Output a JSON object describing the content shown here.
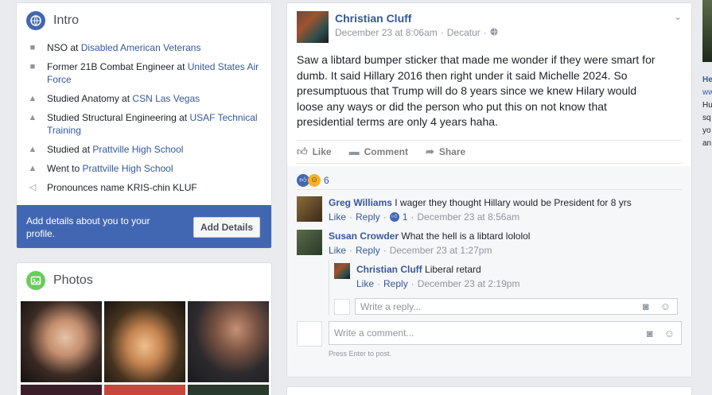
{
  "intro": {
    "title": "Intro",
    "items": [
      {
        "icon": "briefcase-icon",
        "prefix": "NSO at ",
        "link": "Disabled American Veterans"
      },
      {
        "icon": "briefcase-icon",
        "prefix": "Former 21B Combat Engineer at ",
        "link": "United States Air Force"
      },
      {
        "icon": "graduation-cap-icon",
        "prefix": "Studied Anatomy at ",
        "link": "CSN Las Vegas"
      },
      {
        "icon": "graduation-cap-icon",
        "prefix": "Studied Structural Engineering at ",
        "link": "USAF Technical Training"
      },
      {
        "icon": "graduation-cap-icon",
        "prefix": "Studied at ",
        "link": "Prattville High School"
      },
      {
        "icon": "graduation-cap-icon",
        "prefix": "Went to ",
        "link": "Prattville High School"
      },
      {
        "icon": "speaker-icon",
        "prefix": "Pronounces name KRIS-chin KLUF",
        "link": ""
      }
    ],
    "prompt": "Add details about you to your profile.",
    "button": "Add Details"
  },
  "photos": {
    "title": "Photos"
  },
  "post": {
    "author": "Christian Cluff",
    "date": "December 23 at 8:06am",
    "location": "Decatur",
    "body": "Saw a libtard bumper sticker that made me wonder if they were smart for dumb. It said Hillary 2016 then right under it said Michelle 2024. So presumptuous that Trump will do 8 years since we knew Hilary would loose any ways or did the person who put this on not know that presidential terms are only 4 years haha.",
    "actions": {
      "like": "Like",
      "comment": "Comment",
      "share": "Share"
    },
    "reaction_count": "6",
    "comments": [
      {
        "name": "Greg Williams",
        "text": "I wager they thought Hillary would be President for 8 yrs",
        "like": "Like",
        "reply": "Reply",
        "likes": "1",
        "time": "December 23 at 8:56am"
      },
      {
        "name": "Susan Crowder",
        "text": "What the hell is a libtard lololol",
        "like": "Like",
        "reply": "Reply",
        "time": "December 23 at 1:27pm"
      }
    ],
    "reply": {
      "name": "Christian Cluff",
      "text": "Liberal retard",
      "like": "Like",
      "reply": "Reply",
      "time": "December 23 at 2:19pm"
    },
    "reply_placeholder": "Write a reply...",
    "comment_placeholder": "Write a comment...",
    "hint": "Press Enter to post."
  },
  "peek": {
    "lines": [
      "He",
      "ww",
      "Hu",
      "sq",
      "yo",
      "an"
    ]
  }
}
